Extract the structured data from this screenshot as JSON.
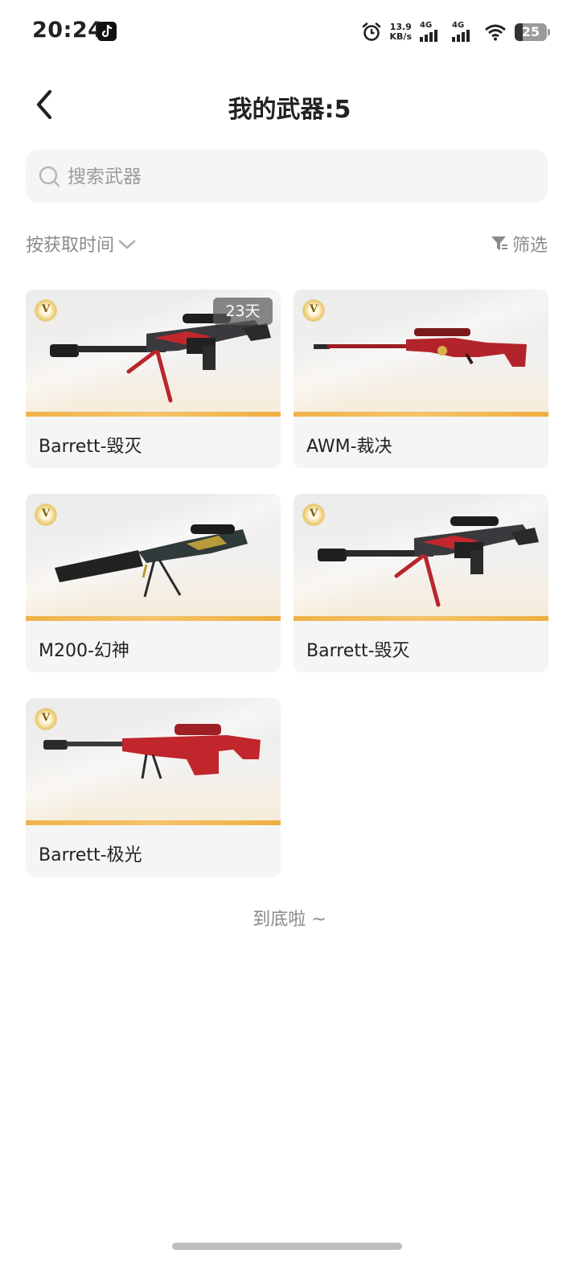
{
  "status_bar": {
    "time": "20:24",
    "net_speed_value": "13.9",
    "net_speed_unit": "KB/s",
    "sim1_tag": "4G",
    "sim2_tag": "4G",
    "battery_level": "25",
    "icons": [
      "tiktok-icon",
      "alarm-icon",
      "signal-icon",
      "signal-icon",
      "wifi-icon",
      "battery-icon"
    ]
  },
  "header": {
    "back_icon": "chevron-left-icon",
    "title": "我的武器:5"
  },
  "search": {
    "placeholder": "搜索武器",
    "value": "",
    "icon": "search-icon"
  },
  "toolbar": {
    "sort_label": "按获取时间",
    "sort_icon": "chevron-down-icon",
    "filter_label": "筛选",
    "filter_icon": "funnel-icon"
  },
  "weapons": [
    {
      "name": "Barrett-毁灭",
      "grade": "V",
      "time_tag": "23天",
      "art": "barrett-dark-rifle"
    },
    {
      "name": "AWM-裁决",
      "grade": "V",
      "time_tag": "",
      "art": "awm-red-rifle"
    },
    {
      "name": "M200-幻神",
      "grade": "V",
      "time_tag": "",
      "art": "m200-black-gold-rifle"
    },
    {
      "name": "Barrett-毁灭",
      "grade": "V",
      "time_tag": "",
      "art": "barrett-dark-rifle"
    },
    {
      "name": "Barrett-极光",
      "grade": "V",
      "time_tag": "",
      "art": "barrett-red-rifle"
    }
  ],
  "footer": {
    "end_text": "到底啦 ~"
  },
  "colors": {
    "accent_bar": "#f0b24a",
    "badge_gold": "#e8c462",
    "text_primary": "#222222",
    "text_secondary": "#8a8a8a"
  }
}
